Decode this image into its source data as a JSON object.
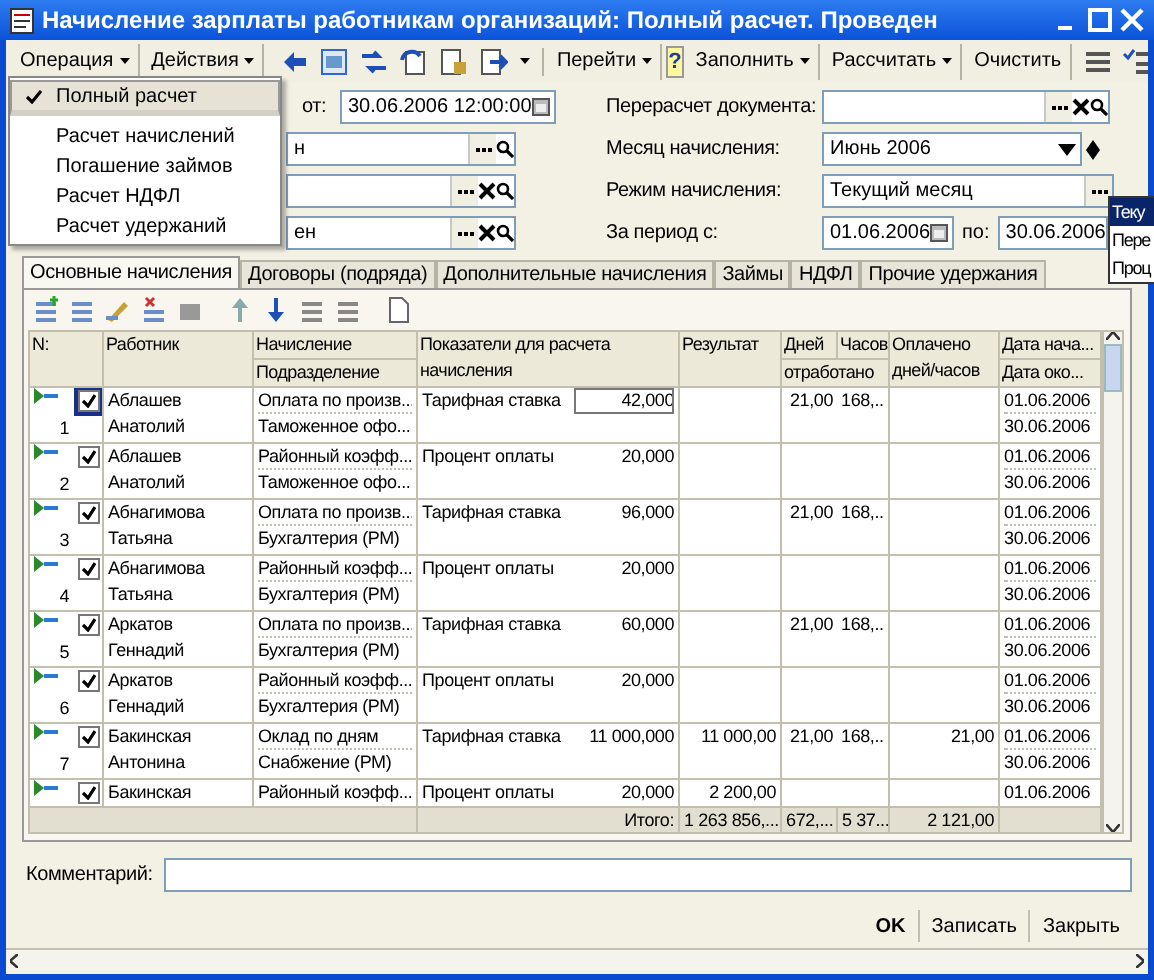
{
  "window": {
    "title": "Начисление зарплаты работникам организаций: Полный расчет. Проведен"
  },
  "toolbar": {
    "left": [
      {
        "label": "Операция",
        "has_menu": true
      },
      {
        "label": "Действия",
        "has_menu": true
      }
    ],
    "goto": {
      "label": "Перейти",
      "has_menu": true
    },
    "help": "?",
    "right": [
      {
        "label": "Заполнить",
        "has_menu": true
      },
      {
        "label": "Рассчитать",
        "has_menu": true
      },
      {
        "label": "Очистить",
        "has_menu": false
      }
    ]
  },
  "operation_menu": [
    {
      "label": "Полный расчет",
      "checked": true,
      "selected": true,
      "separator_after": true
    },
    {
      "label": "Расчет начислений",
      "checked": false,
      "selected": false,
      "separator_after": false
    },
    {
      "label": "Погашение займов",
      "checked": false,
      "selected": false,
      "separator_after": false
    },
    {
      "label": "Расчет НДФЛ",
      "checked": false,
      "selected": false,
      "separator_after": false
    },
    {
      "label": "Расчет удержаний",
      "checked": false,
      "selected": false,
      "separator_after": false
    }
  ],
  "header_left": {
    "date_label": "от:",
    "date": "30.06.2006 12:00:00",
    "field_2": "н",
    "field_4": "ен"
  },
  "header_right": {
    "recalc_label": "Перерасчет документа:",
    "month_label": "Месяц начисления:",
    "month": "Июнь 2006",
    "mode_label": "Режим начисления:",
    "mode": "Текущий месяц",
    "period_label": "За период с:",
    "period_from": "01.06.2006",
    "period_to_label": "по:",
    "period_to": "30.06.2006"
  },
  "mode_list": [
    {
      "label": "Теку",
      "selected": true
    },
    {
      "label": "Пере",
      "selected": false
    },
    {
      "label": "Проц",
      "selected": false
    }
  ],
  "tabs": [
    {
      "label": "Основные начисления",
      "selected": true
    },
    {
      "label": "Договоры (подряда)",
      "selected": false
    },
    {
      "label": "Дополнительные начисления",
      "selected": false
    },
    {
      "label": "Займы",
      "selected": false
    },
    {
      "label": "НДФЛ",
      "selected": false
    },
    {
      "label": "Прочие удержания",
      "selected": false
    }
  ],
  "table": {
    "header": {
      "number": "N:",
      "employee": "Работник",
      "accrual": "Начисление",
      "department": "Подразделение",
      "indicators": "Показатели для расчета начисления",
      "result": "Результат",
      "days": "Дней",
      "hours": "Часов",
      "worked": "отработано",
      "paid": "Оплачено дней/часов",
      "date_start": "Дата нача...",
      "date_end": "Дата око..."
    },
    "rows": [
      {
        "number": "1",
        "checked": true,
        "focused": true,
        "employee": "Аблашев Анатолий",
        "accrual": "Оплата по произв...",
        "department": "Таможенное офо...",
        "indicator": "Тарифная ставка",
        "value": "42,000",
        "days": "21,00",
        "hours": "168,...",
        "date_start": "01.06.2006",
        "date_end": "30.06.2006"
      },
      {
        "number": "2",
        "checked": true,
        "focused": false,
        "employee": "Аблашев Анатолий",
        "accrual": "Районный коэфф...",
        "department": "Таможенное офо...",
        "indicator": "Процент оплаты",
        "value": "20,000",
        "date_start": "01.06.2006",
        "date_end": "30.06.2006"
      },
      {
        "number": "3",
        "checked": true,
        "focused": false,
        "employee": "Абнагимова Татьяна",
        "accrual": "Оплата по произв...",
        "department": "Бухгалтерия (РМ)",
        "indicator": "Тарифная ставка",
        "value": "96,000",
        "days": "21,00",
        "hours": "168,...",
        "date_start": "01.06.2006",
        "date_end": "30.06.2006"
      },
      {
        "number": "4",
        "checked": true,
        "focused": false,
        "employee": "Абнагимова Татьяна",
        "accrual": "Районный коэфф...",
        "department": "Бухгалтерия (РМ)",
        "indicator": "Процент оплаты",
        "value": "20,000",
        "date_start": "01.06.2006",
        "date_end": "30.06.2006"
      },
      {
        "number": "5",
        "checked": true,
        "focused": false,
        "employee": "Аркатов Геннадий",
        "accrual": "Оплата по произв...",
        "department": "Бухгалтерия (РМ)",
        "indicator": "Тарифная ставка",
        "value": "60,000",
        "days": "21,00",
        "hours": "168,...",
        "date_start": "01.06.2006",
        "date_end": "30.06.2006"
      },
      {
        "number": "6",
        "checked": true,
        "focused": false,
        "employee": "Аркатов Геннадий",
        "accrual": "Районный коэфф...",
        "department": "Бухгалтерия (РМ)",
        "indicator": "Процент оплаты",
        "value": "20,000",
        "date_start": "01.06.2006",
        "date_end": "30.06.2006"
      },
      {
        "number": "7",
        "checked": true,
        "focused": false,
        "employee": "Бакинская Антонина",
        "accrual": "Оклад по дням",
        "department": "Снабжение (РМ)",
        "indicator": "Тарифная ставка",
        "value": "11 000,000",
        "result": "11 000,00",
        "days": "21,00",
        "hours": "168,...",
        "paid": "21,00",
        "date_start": "01.06.2006",
        "date_end": "30.06.2006"
      },
      {
        "checked": true,
        "focused": false,
        "employee": "Бакинская",
        "accrual": "Районный коэфф...",
        "indicator": "Процент оплаты",
        "value": "20,000",
        "result": "2 200,00",
        "date_start": "01.06.2006"
      }
    ],
    "totals": {
      "label": "Итого:",
      "result": "1 263 856,...",
      "days": "672,...",
      "hours": "5 37...",
      "paid": "2 121,00"
    }
  },
  "comment_label": "Комментарий:",
  "buttons": [
    {
      "label": "OK",
      "default": true
    },
    {
      "label": "Записать",
      "default": false
    },
    {
      "label": "Закрыть",
      "default": false
    }
  ]
}
